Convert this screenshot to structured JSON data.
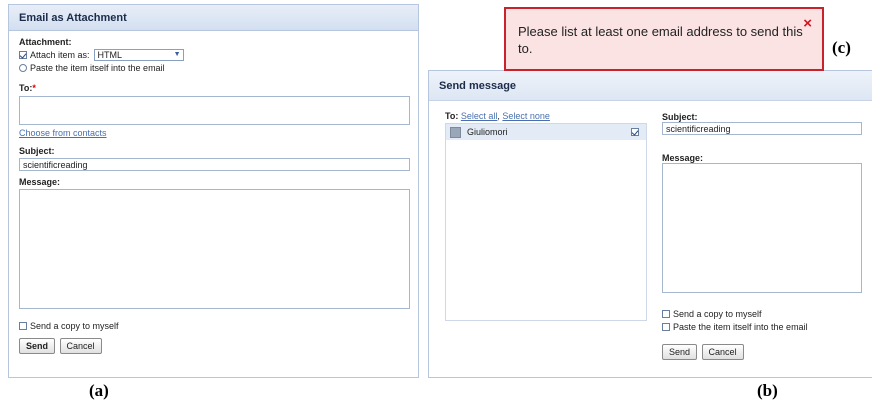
{
  "panel_a": {
    "title": "Email as Attachment",
    "attachment_label": "Attachment:",
    "attach_item_label": "Attach item as:",
    "attach_format": "HTML",
    "paste_label": "Paste the item itself into the email",
    "to_label": "To:",
    "to_required": "*",
    "choose_contacts": "Choose from contacts",
    "subject_label": "Subject:",
    "subject_value": "scientificreading",
    "message_label": "Message:",
    "copy_label": "Send a copy to myself",
    "send_label": "Send",
    "cancel_label": "Cancel"
  },
  "panel_b": {
    "title": "Send message",
    "to_label": "To:",
    "select_all": "Select all",
    "sep": ",",
    "select_none": "Select none",
    "contact_name": "Giuliomori",
    "subject_label": "Subject:",
    "subject_value": "scientificreading",
    "message_label": "Message:",
    "copy_label": "Send a copy to myself",
    "paste_label": "Paste the item itself into the email",
    "send_label": "Send",
    "cancel_label": "Cancel"
  },
  "error": {
    "message": "Please list at least one email address to send this to.",
    "close_glyph": "×"
  },
  "captions": {
    "a": "(a)",
    "b": "(b)",
    "c": "(c)"
  }
}
